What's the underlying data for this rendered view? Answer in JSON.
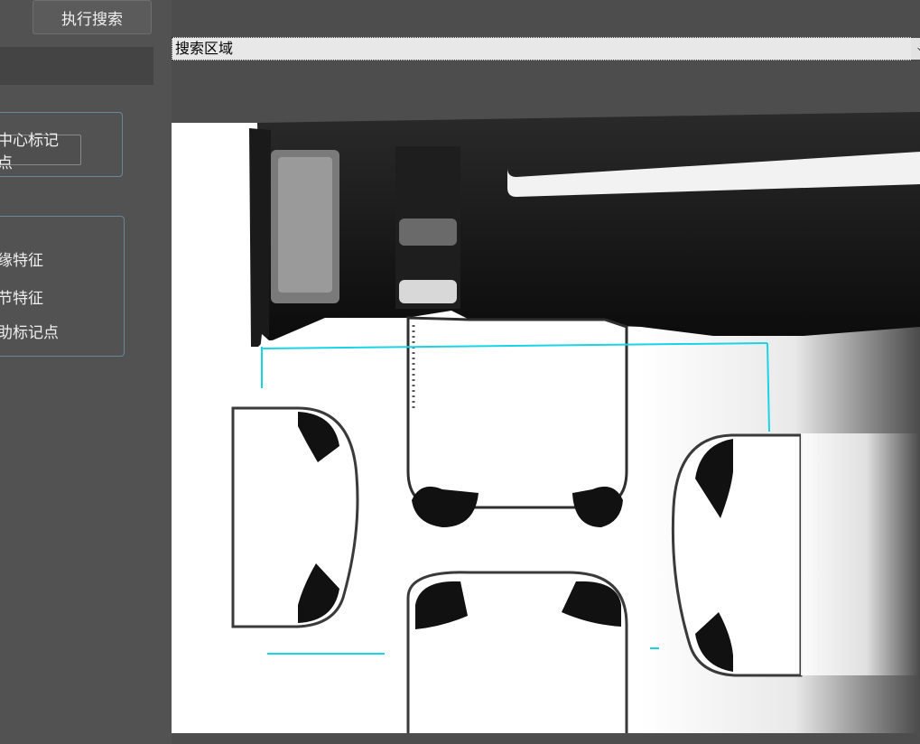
{
  "toolbar": {
    "execute_search_label": "执行搜索"
  },
  "search_region": {
    "selected": "搜索区域"
  },
  "marker_group": {
    "center_marker_button": "中心标记点"
  },
  "feature_group": {
    "options": [
      "边缘特征",
      "细节特征",
      "辅助标记点"
    ],
    "visible_labels": [
      "缘特征",
      "细特征",
      "助标记点"
    ]
  },
  "colors": {
    "overlay": "#19d4e6",
    "panel": "#525252",
    "background": "#4d4d4d"
  },
  "icons": {
    "dropdown": "chevron-down-icon"
  }
}
